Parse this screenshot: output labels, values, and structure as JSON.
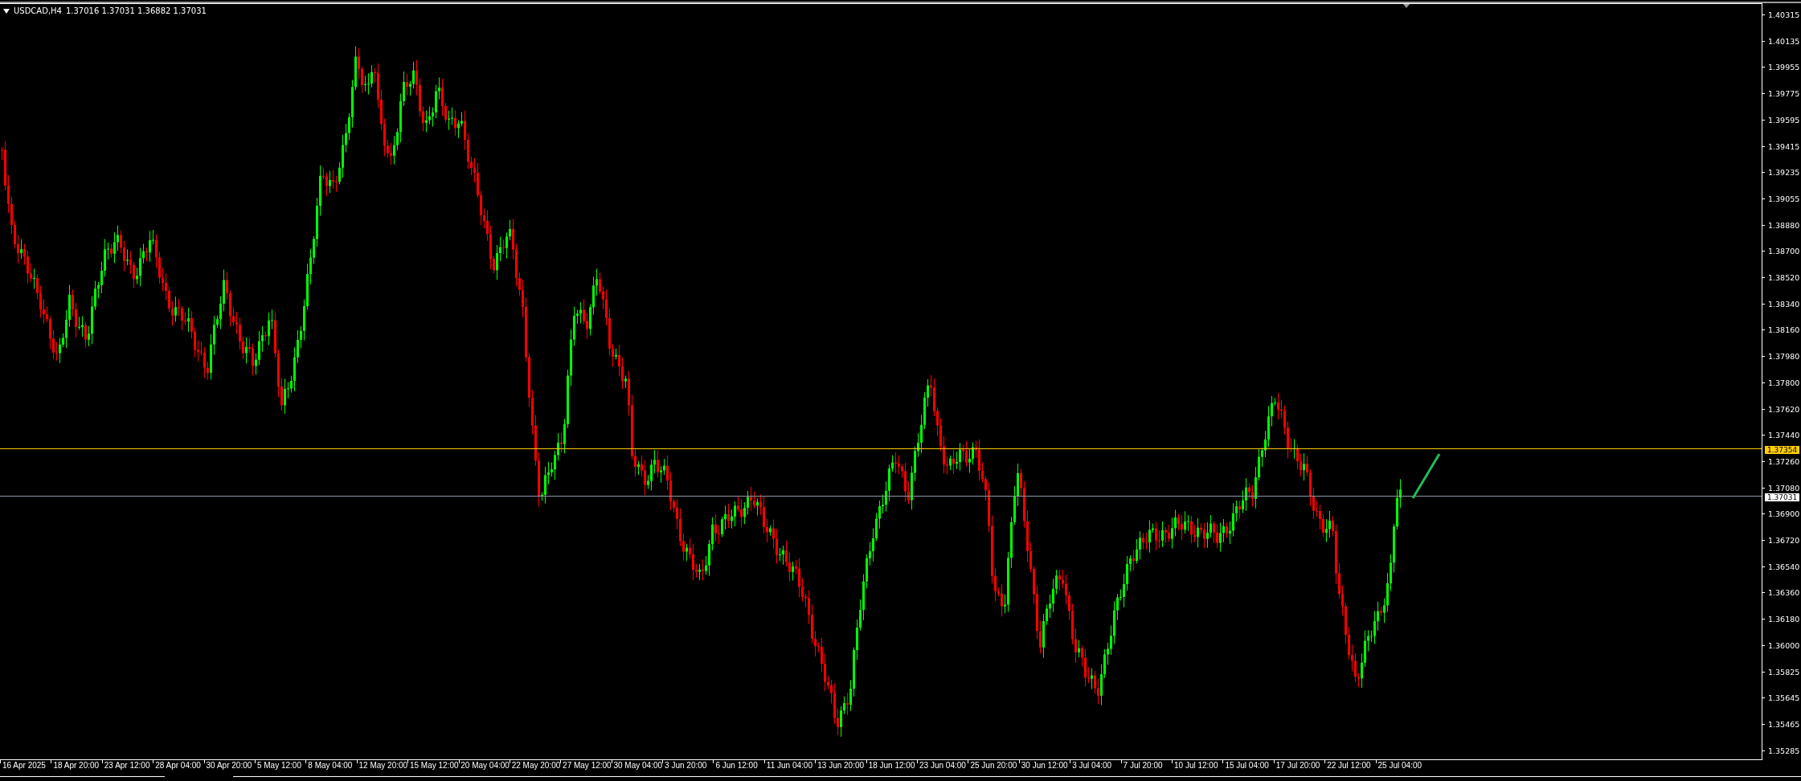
{
  "chart": {
    "symbol": "USDCAD,H4",
    "ohlc": "1.37016 1.37031 1.36882 1.37031"
  },
  "price_axis": {
    "labels": [
      "1.40315",
      "1.40135",
      "1.39955",
      "1.39775",
      "1.39595",
      "1.39415",
      "1.39235",
      "1.39055",
      "1.38880",
      "1.38700",
      "1.38520",
      "1.38340",
      "1.38160",
      "1.37980",
      "1.37800",
      "1.37620",
      "1.37440",
      "1.37260",
      "1.37080",
      "1.36900",
      "1.36720",
      "1.36540",
      "1.36360",
      "1.36180",
      "1.36000",
      "1.35825",
      "1.35645",
      "1.35465",
      "1.35285"
    ]
  },
  "price_lines": [
    {
      "label": "1.37354",
      "color": "#ffcc00"
    },
    {
      "label": "1.37031",
      "color": "#ffffff"
    }
  ],
  "time_axis": {
    "labels": [
      "16 Apr 2025",
      "18 Apr 20:00",
      "23 Apr 12:00",
      "28 Apr 04:00",
      "30 Apr 20:00",
      "5 May 12:00",
      "8 May 04:00",
      "12 May 20:00",
      "15 May 12:00",
      "20 May 04:00",
      "22 May 20:00",
      "27 May 12:00",
      "30 May 04:00",
      "3 Jun 20:00",
      "6 Jun 12:00",
      "11 Jun 04:00",
      "13 Jun 20:00",
      "18 Jun 12:00",
      "23 Jun 04:00",
      "25 Jun 20:00",
      "30 Jun 12:00",
      "3 Jul 04:00",
      "7 Jul 20:00",
      "10 Jul 12:00",
      "15 Jul 04:00",
      "17 Jul 20:00",
      "22 Jul 12:00",
      "25 Jul 04:00"
    ]
  }
}
